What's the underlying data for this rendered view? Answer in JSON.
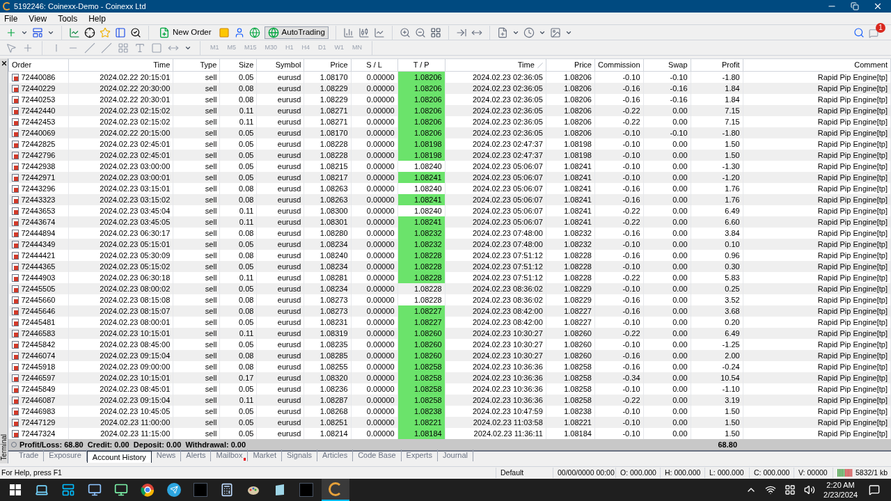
{
  "window": {
    "title": "5192246: Coinexx-Demo - Coinexx Ltd"
  },
  "menu": [
    "File",
    "View",
    "Tools",
    "Help"
  ],
  "toolbar": {
    "new_order": "New Order",
    "autotrading": {
      "label": "AutoTrading",
      "on": true
    },
    "notification_count": "1"
  },
  "timeframes": [
    "M1",
    "M5",
    "M15",
    "M30",
    "H1",
    "H4",
    "D1",
    "W1",
    "MN"
  ],
  "table": {
    "columns": [
      "Order",
      "Time",
      "Type",
      "Size",
      "Symbol",
      "Price",
      "S / L",
      "T / P",
      "Time",
      "Price",
      "Commission",
      "Swap",
      "Profit",
      "Comment"
    ],
    "rows": [
      {
        "cells": [
          "72440086",
          "2024.02.22 20:15:01",
          "sell",
          "0.05",
          "eurusd",
          "1.08170",
          "0.00000",
          "1.08206",
          "2024.02.23 02:36:05",
          "1.08206",
          "-0.10",
          "-0.10",
          "-1.80",
          "Rapid Pip Engine[tp]"
        ],
        "tp_hit": true
      },
      {
        "cells": [
          "72440229",
          "2024.02.22 20:30:00",
          "sell",
          "0.08",
          "eurusd",
          "1.08229",
          "0.00000",
          "1.08206",
          "2024.02.23 02:36:05",
          "1.08206",
          "-0.16",
          "-0.16",
          "1.84",
          "Rapid Pip Engine[tp]"
        ],
        "tp_hit": true
      },
      {
        "cells": [
          "72440253",
          "2024.02.22 20:30:01",
          "sell",
          "0.08",
          "eurusd",
          "1.08229",
          "0.00000",
          "1.08206",
          "2024.02.23 02:36:05",
          "1.08206",
          "-0.16",
          "-0.16",
          "1.84",
          "Rapid Pip Engine[tp]"
        ],
        "tp_hit": true
      },
      {
        "cells": [
          "72442440",
          "2024.02.23 02:15:02",
          "sell",
          "0.11",
          "eurusd",
          "1.08271",
          "0.00000",
          "1.08206",
          "2024.02.23 02:36:05",
          "1.08206",
          "-0.22",
          "0.00",
          "7.15",
          "Rapid Pip Engine[tp]"
        ],
        "tp_hit": true
      },
      {
        "cells": [
          "72442453",
          "2024.02.23 02:15:02",
          "sell",
          "0.11",
          "eurusd",
          "1.08271",
          "0.00000",
          "1.08206",
          "2024.02.23 02:36:05",
          "1.08206",
          "-0.22",
          "0.00",
          "7.15",
          "Rapid Pip Engine[tp]"
        ],
        "tp_hit": true
      },
      {
        "cells": [
          "72440069",
          "2024.02.22 20:15:00",
          "sell",
          "0.05",
          "eurusd",
          "1.08170",
          "0.00000",
          "1.08206",
          "2024.02.23 02:36:05",
          "1.08206",
          "-0.10",
          "-0.10",
          "-1.80",
          "Rapid Pip Engine[tp]"
        ],
        "tp_hit": true
      },
      {
        "cells": [
          "72442825",
          "2024.02.23 02:45:01",
          "sell",
          "0.05",
          "eurusd",
          "1.08228",
          "0.00000",
          "1.08198",
          "2024.02.23 02:47:37",
          "1.08198",
          "-0.10",
          "0.00",
          "1.50",
          "Rapid Pip Engine[tp]"
        ],
        "tp_hit": true
      },
      {
        "cells": [
          "72442796",
          "2024.02.23 02:45:01",
          "sell",
          "0.05",
          "eurusd",
          "1.08228",
          "0.00000",
          "1.08198",
          "2024.02.23 02:47:37",
          "1.08198",
          "-0.10",
          "0.00",
          "1.50",
          "Rapid Pip Engine[tp]"
        ],
        "tp_hit": true
      },
      {
        "cells": [
          "72442938",
          "2024.02.23 03:00:00",
          "sell",
          "0.05",
          "eurusd",
          "1.08215",
          "0.00000",
          "1.08240",
          "2024.02.23 05:06:07",
          "1.08241",
          "-0.10",
          "0.00",
          "-1.30",
          "Rapid Pip Engine[tp]"
        ],
        "tp_hit": false
      },
      {
        "cells": [
          "72442971",
          "2024.02.23 03:00:01",
          "sell",
          "0.05",
          "eurusd",
          "1.08217",
          "0.00000",
          "1.08241",
          "2024.02.23 05:06:07",
          "1.08241",
          "-0.10",
          "0.00",
          "-1.20",
          "Rapid Pip Engine[tp]"
        ],
        "tp_hit": true
      },
      {
        "cells": [
          "72443296",
          "2024.02.23 03:15:01",
          "sell",
          "0.08",
          "eurusd",
          "1.08263",
          "0.00000",
          "1.08240",
          "2024.02.23 05:06:07",
          "1.08241",
          "-0.16",
          "0.00",
          "1.76",
          "Rapid Pip Engine[tp]"
        ],
        "tp_hit": false
      },
      {
        "cells": [
          "72443323",
          "2024.02.23 03:15:02",
          "sell",
          "0.08",
          "eurusd",
          "1.08263",
          "0.00000",
          "1.08241",
          "2024.02.23 05:06:07",
          "1.08241",
          "-0.16",
          "0.00",
          "1.76",
          "Rapid Pip Engine[tp]"
        ],
        "tp_hit": true
      },
      {
        "cells": [
          "72443653",
          "2024.02.23 03:45:04",
          "sell",
          "0.11",
          "eurusd",
          "1.08300",
          "0.00000",
          "1.08240",
          "2024.02.23 05:06:07",
          "1.08241",
          "-0.22",
          "0.00",
          "6.49",
          "Rapid Pip Engine[tp]"
        ],
        "tp_hit": false
      },
      {
        "cells": [
          "72443674",
          "2024.02.23 03:45:05",
          "sell",
          "0.11",
          "eurusd",
          "1.08301",
          "0.00000",
          "1.08241",
          "2024.02.23 05:06:07",
          "1.08241",
          "-0.22",
          "0.00",
          "6.60",
          "Rapid Pip Engine[tp]"
        ],
        "tp_hit": true
      },
      {
        "cells": [
          "72444894",
          "2024.02.23 06:30:17",
          "sell",
          "0.08",
          "eurusd",
          "1.08280",
          "0.00000",
          "1.08232",
          "2024.02.23 07:48:00",
          "1.08232",
          "-0.16",
          "0.00",
          "3.84",
          "Rapid Pip Engine[tp]"
        ],
        "tp_hit": true
      },
      {
        "cells": [
          "72444349",
          "2024.02.23 05:15:01",
          "sell",
          "0.05",
          "eurusd",
          "1.08234",
          "0.00000",
          "1.08232",
          "2024.02.23 07:48:00",
          "1.08232",
          "-0.10",
          "0.00",
          "0.10",
          "Rapid Pip Engine[tp]"
        ],
        "tp_hit": true
      },
      {
        "cells": [
          "72444421",
          "2024.02.23 05:30:09",
          "sell",
          "0.08",
          "eurusd",
          "1.08240",
          "0.00000",
          "1.08228",
          "2024.02.23 07:51:12",
          "1.08228",
          "-0.16",
          "0.00",
          "0.96",
          "Rapid Pip Engine[tp]"
        ],
        "tp_hit": true
      },
      {
        "cells": [
          "72444365",
          "2024.02.23 05:15:02",
          "sell",
          "0.05",
          "eurusd",
          "1.08234",
          "0.00000",
          "1.08228",
          "2024.02.23 07:51:12",
          "1.08228",
          "-0.10",
          "0.00",
          "0.30",
          "Rapid Pip Engine[tp]"
        ],
        "tp_hit": true
      },
      {
        "cells": [
          "72444903",
          "2024.02.23 06:30:18",
          "sell",
          "0.11",
          "eurusd",
          "1.08281",
          "0.00000",
          "1.08228",
          "2024.02.23 07:51:12",
          "1.08228",
          "-0.22",
          "0.00",
          "5.83",
          "Rapid Pip Engine[tp]"
        ],
        "tp_hit": true
      },
      {
        "cells": [
          "72445505",
          "2024.02.23 08:00:02",
          "sell",
          "0.05",
          "eurusd",
          "1.08234",
          "0.00000",
          "1.08228",
          "2024.02.23 08:36:02",
          "1.08229",
          "-0.10",
          "0.00",
          "0.25",
          "Rapid Pip Engine[tp]"
        ],
        "tp_hit": false
      },
      {
        "cells": [
          "72445660",
          "2024.02.23 08:15:08",
          "sell",
          "0.08",
          "eurusd",
          "1.08273",
          "0.00000",
          "1.08228",
          "2024.02.23 08:36:02",
          "1.08229",
          "-0.16",
          "0.00",
          "3.52",
          "Rapid Pip Engine[tp]"
        ],
        "tp_hit": false
      },
      {
        "cells": [
          "72445646",
          "2024.02.23 08:15:07",
          "sell",
          "0.08",
          "eurusd",
          "1.08273",
          "0.00000",
          "1.08227",
          "2024.02.23 08:42:00",
          "1.08227",
          "-0.16",
          "0.00",
          "3.68",
          "Rapid Pip Engine[tp]"
        ],
        "tp_hit": true
      },
      {
        "cells": [
          "72445481",
          "2024.02.23 08:00:01",
          "sell",
          "0.05",
          "eurusd",
          "1.08231",
          "0.00000",
          "1.08227",
          "2024.02.23 08:42:00",
          "1.08227",
          "-0.10",
          "0.00",
          "0.20",
          "Rapid Pip Engine[tp]"
        ],
        "tp_hit": true
      },
      {
        "cells": [
          "72446583",
          "2024.02.23 10:15:01",
          "sell",
          "0.11",
          "eurusd",
          "1.08319",
          "0.00000",
          "1.08260",
          "2024.02.23 10:30:27",
          "1.08260",
          "-0.22",
          "0.00",
          "6.49",
          "Rapid Pip Engine[tp]"
        ],
        "tp_hit": true
      },
      {
        "cells": [
          "72445842",
          "2024.02.23 08:45:00",
          "sell",
          "0.05",
          "eurusd",
          "1.08235",
          "0.00000",
          "1.08260",
          "2024.02.23 10:30:27",
          "1.08260",
          "-0.10",
          "0.00",
          "-1.25",
          "Rapid Pip Engine[tp]"
        ],
        "tp_hit": true
      },
      {
        "cells": [
          "72446074",
          "2024.02.23 09:15:04",
          "sell",
          "0.08",
          "eurusd",
          "1.08285",
          "0.00000",
          "1.08260",
          "2024.02.23 10:30:27",
          "1.08260",
          "-0.16",
          "0.00",
          "2.00",
          "Rapid Pip Engine[tp]"
        ],
        "tp_hit": true
      },
      {
        "cells": [
          "72445918",
          "2024.02.23 09:00:00",
          "sell",
          "0.08",
          "eurusd",
          "1.08255",
          "0.00000",
          "1.08258",
          "2024.02.23 10:36:36",
          "1.08258",
          "-0.16",
          "0.00",
          "-0.24",
          "Rapid Pip Engine[tp]"
        ],
        "tp_hit": true
      },
      {
        "cells": [
          "72446597",
          "2024.02.23 10:15:01",
          "sell",
          "0.17",
          "eurusd",
          "1.08320",
          "0.00000",
          "1.08258",
          "2024.02.23 10:36:36",
          "1.08258",
          "-0.34",
          "0.00",
          "10.54",
          "Rapid Pip Engine[tp]"
        ],
        "tp_hit": true
      },
      {
        "cells": [
          "72445849",
          "2024.02.23 08:45:01",
          "sell",
          "0.05",
          "eurusd",
          "1.08236",
          "0.00000",
          "1.08258",
          "2024.02.23 10:36:36",
          "1.08258",
          "-0.10",
          "0.00",
          "-1.10",
          "Rapid Pip Engine[tp]"
        ],
        "tp_hit": true
      },
      {
        "cells": [
          "72446087",
          "2024.02.23 09:15:04",
          "sell",
          "0.11",
          "eurusd",
          "1.08287",
          "0.00000",
          "1.08258",
          "2024.02.23 10:36:36",
          "1.08258",
          "-0.22",
          "0.00",
          "3.19",
          "Rapid Pip Engine[tp]"
        ],
        "tp_hit": true
      },
      {
        "cells": [
          "72446983",
          "2024.02.23 10:45:05",
          "sell",
          "0.05",
          "eurusd",
          "1.08268",
          "0.00000",
          "1.08238",
          "2024.02.23 10:47:59",
          "1.08238",
          "-0.10",
          "0.00",
          "1.50",
          "Rapid Pip Engine[tp]"
        ],
        "tp_hit": true
      },
      {
        "cells": [
          "72447129",
          "2024.02.23 11:00:00",
          "sell",
          "0.05",
          "eurusd",
          "1.08251",
          "0.00000",
          "1.08221",
          "2024.02.23 11:03:58",
          "1.08221",
          "-0.10",
          "0.00",
          "1.50",
          "Rapid Pip Engine[tp]"
        ],
        "tp_hit": true
      },
      {
        "cells": [
          "72447324",
          "2024.02.23 11:15:00",
          "sell",
          "0.05",
          "eurusd",
          "1.08214",
          "0.00000",
          "1.08184",
          "2024.02.23 11:36:11",
          "1.08184",
          "-0.10",
          "0.00",
          "1.50",
          "Rapid Pip Engine[tp]"
        ],
        "tp_hit": true
      }
    ],
    "summary": {
      "text": "Profit/Loss: 68.80  Credit: 0.00  Deposit: 0.00  Withdrawal: 0.00",
      "total": "68.80"
    }
  },
  "terminal_label": "Terminal",
  "tabs": [
    {
      "label": "Trade",
      "selected": false
    },
    {
      "label": "Exposure",
      "selected": false
    },
    {
      "label": "Account History",
      "selected": true
    },
    {
      "label": "News",
      "selected": false
    },
    {
      "label": "Alerts",
      "selected": false
    },
    {
      "label": "Mailbox",
      "selected": false,
      "unread": true
    },
    {
      "label": "Market",
      "selected": false
    },
    {
      "label": "Signals",
      "selected": false
    },
    {
      "label": "Articles",
      "selected": false
    },
    {
      "label": "Code Base",
      "selected": false
    },
    {
      "label": "Experts",
      "selected": false
    },
    {
      "label": "Journal",
      "selected": false
    }
  ],
  "status_bar": {
    "help": "For Help, press F1",
    "profile": "Default",
    "date": "00/00/0000 00:00",
    "open": "O: 000.000",
    "high": "H: 000.000",
    "low": "L: 000.000",
    "close": "C: 000.000",
    "volume": "V: 00000",
    "traffic": "5832/1 kb"
  },
  "taskbar": {
    "time": "2:20 AM",
    "date": "2/23/2024"
  }
}
